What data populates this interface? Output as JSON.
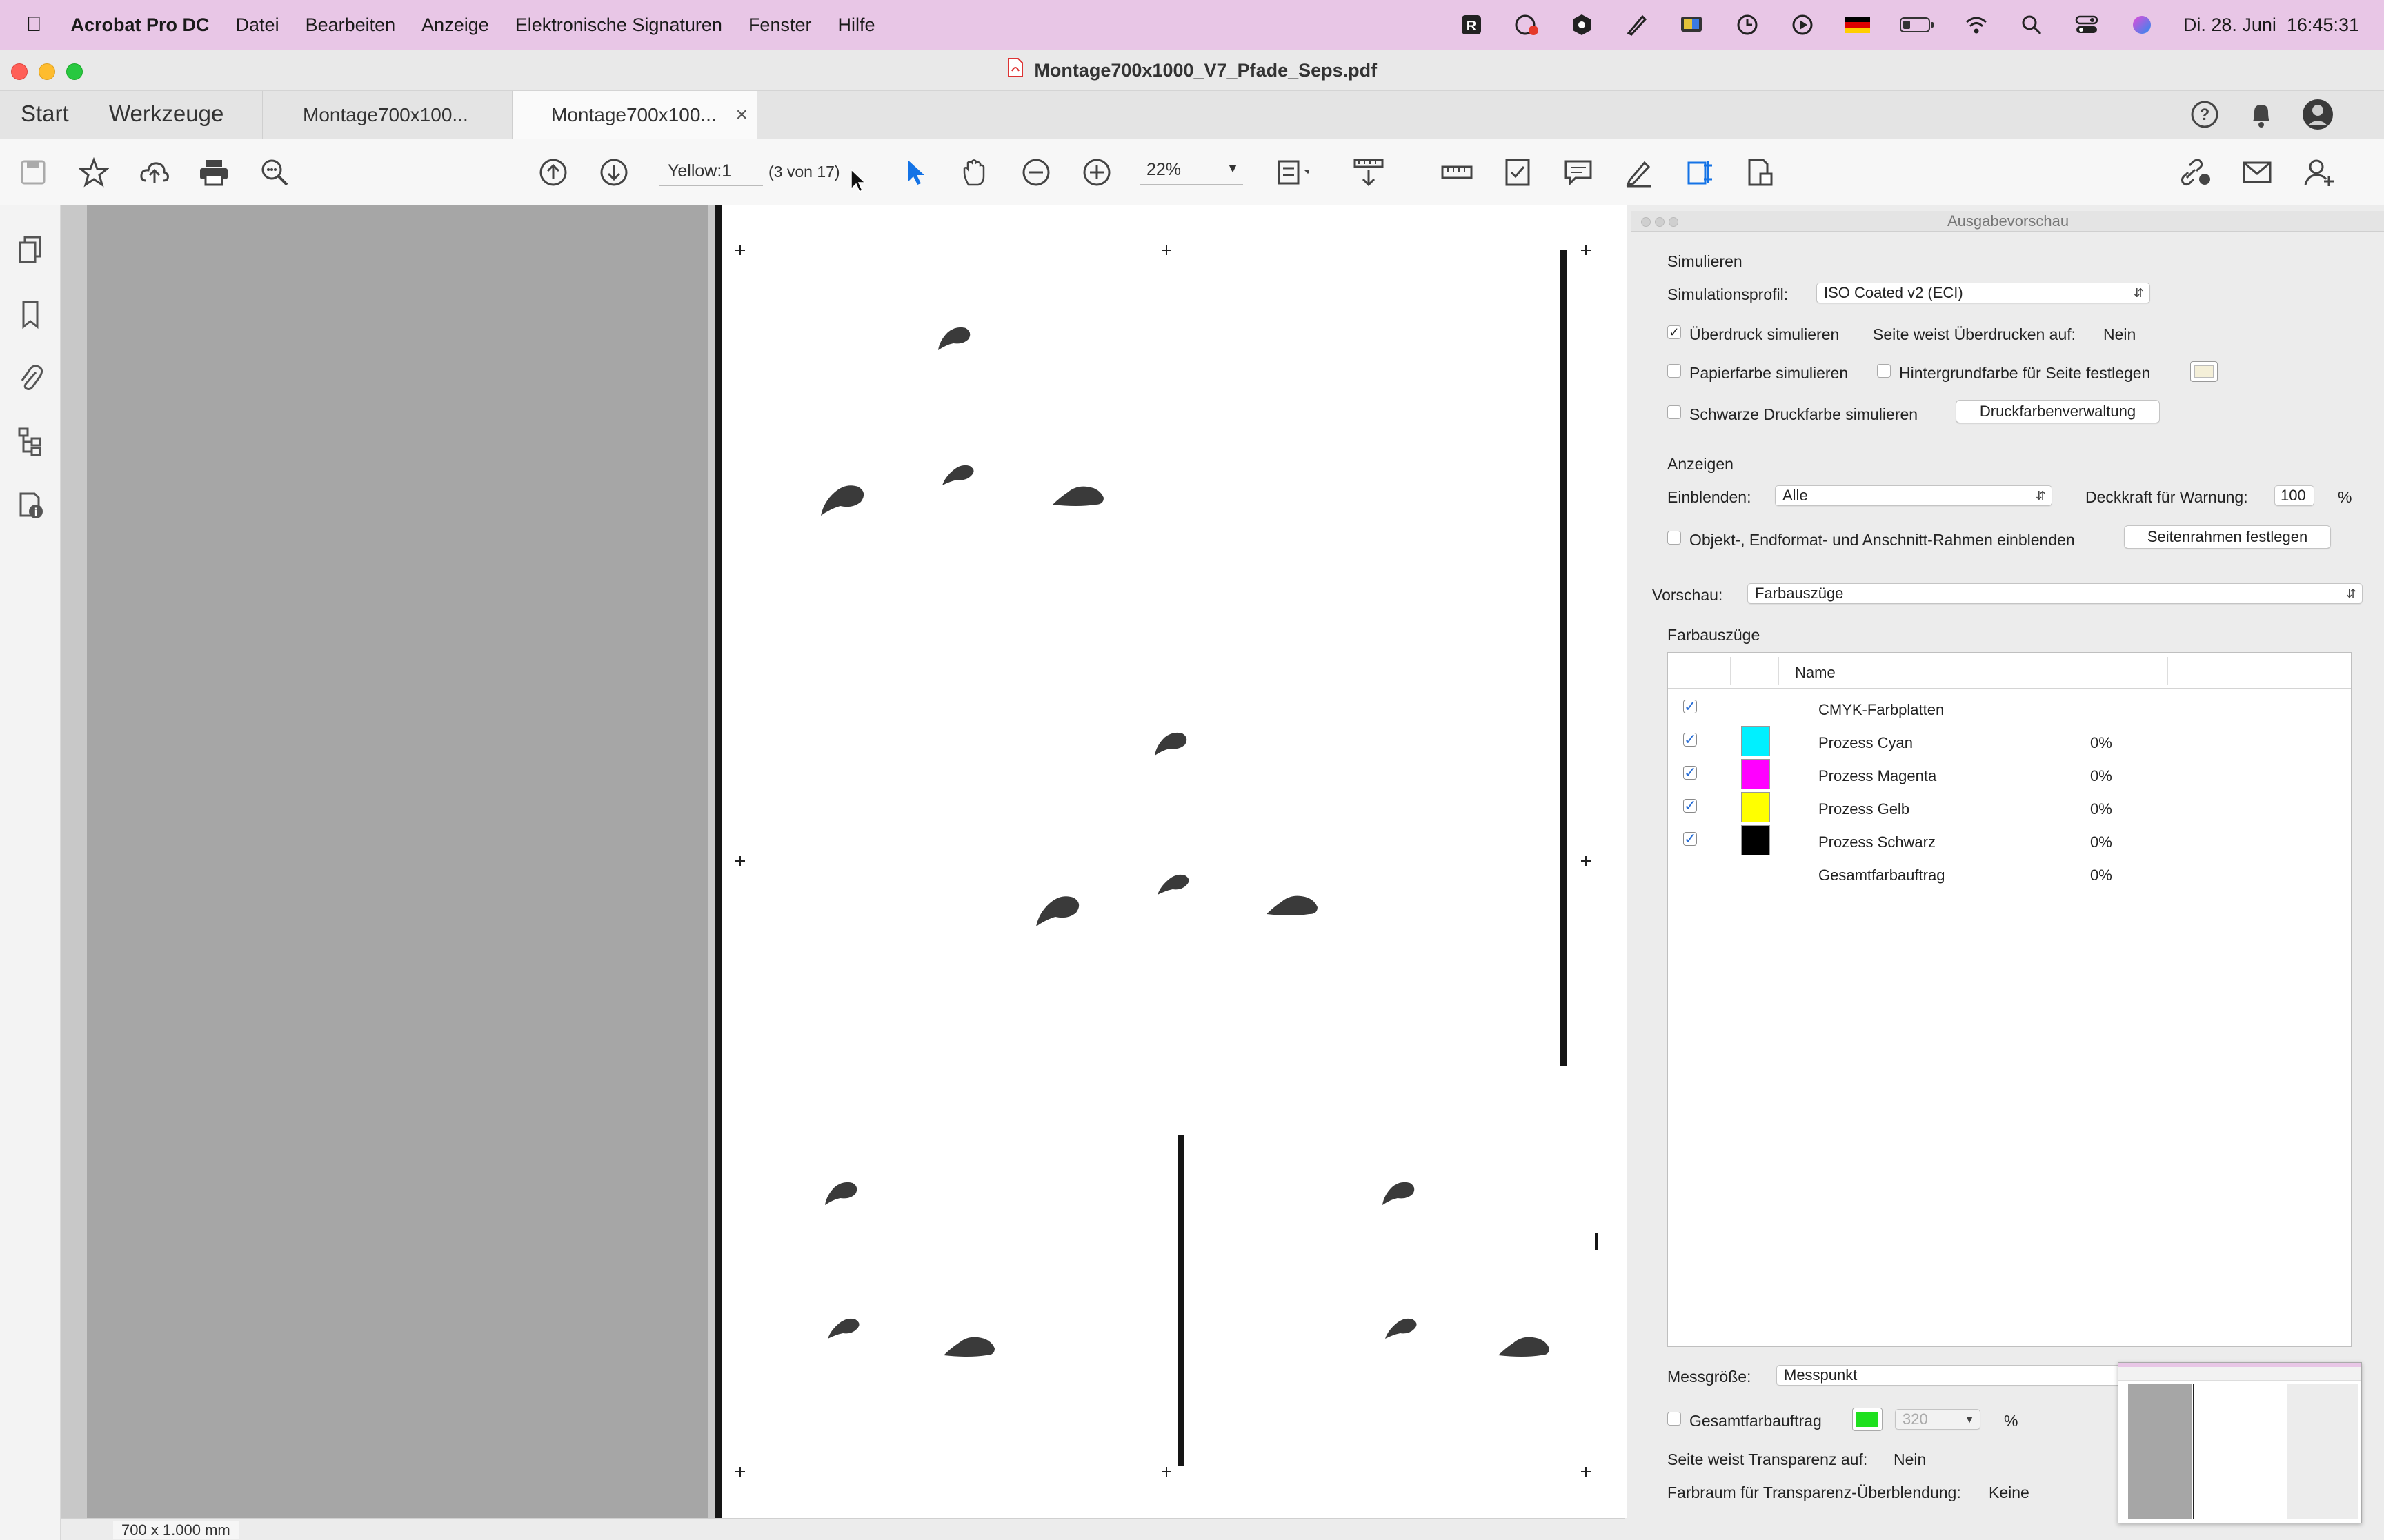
{
  "menubar": {
    "app": "Acrobat Pro DC",
    "items": [
      "Datei",
      "Bearbeiten",
      "Anzeige",
      "Elektronische Signaturen",
      "Fenster",
      "Hilfe"
    ],
    "datetime": "Di. 28. Juni  16:45:31",
    "icons": [
      "ps-icon",
      "gauge-icon",
      "hex-icon",
      "pen-icon",
      "display-icon",
      "history-icon",
      "play-icon",
      "flag-de-icon",
      "battery-icon",
      "wifi-icon",
      "search-icon",
      "control-center-icon",
      "siri-icon"
    ]
  },
  "window": {
    "title": "Montage700x1000_V7_Pfade_Seps.pdf"
  },
  "tabs": {
    "start": "Start",
    "tools": "Werkzeuge",
    "documents": [
      {
        "label": "Montage700x100..."
      },
      {
        "label": "Montage700x100..."
      }
    ],
    "close_glyph": "×"
  },
  "toolbar": {
    "page_field": "Yellow:1",
    "page_count": "(3 von 17)",
    "zoom": "22%"
  },
  "document": {
    "page_size": "700 x 1.000 mm"
  },
  "panel": {
    "title": "Ausgabevorschau",
    "simulate": {
      "heading": "Simulieren",
      "profile_label": "Simulationsprofil:",
      "profile_value": "ISO Coated v2 (ECI)",
      "overprint_label": "Überdruck simulieren",
      "overprint_checked": true,
      "page_overprint_label": "Seite weist Überdrucken auf:",
      "page_overprint_value": "Nein",
      "paper_label": "Papierfarbe simulieren",
      "background_label": "Hintergrundfarbe für Seite festlegen",
      "black_ink_label": "Schwarze Druckfarbe simulieren",
      "ink_manager_button": "Druckfarbenverwaltung"
    },
    "show": {
      "heading": "Anzeigen",
      "show_label": "Einblenden:",
      "show_value": "Alle",
      "opacity_label": "Deckkraft für Warnung:",
      "opacity_value": "100",
      "opacity_unit": "%",
      "frames_label": "Objekt-, Endformat- und Anschnitt-Rahmen einblenden",
      "frames_button": "Seitenrahmen festlegen"
    },
    "preview": {
      "label": "Vorschau:",
      "value": "Farbauszüge"
    },
    "separations": {
      "heading": "Farbauszüge",
      "column_name": "Name",
      "rows": [
        {
          "name": "CMYK-Farbplatten",
          "checked": true,
          "color": "",
          "value": ""
        },
        {
          "name": "Prozess Cyan",
          "checked": true,
          "color": "#00f0ff",
          "value": "0%"
        },
        {
          "name": "Prozess Magenta",
          "checked": true,
          "color": "#ff00ff",
          "value": "0%"
        },
        {
          "name": "Prozess Gelb",
          "checked": true,
          "color": "#ffff00",
          "value": "0%"
        },
        {
          "name": "Prozess Schwarz",
          "checked": true,
          "color": "#000000",
          "value": "0%"
        },
        {
          "name": "Gesamtfarbauftrag",
          "checked": false,
          "color": "",
          "value": "0%"
        }
      ]
    },
    "measure": {
      "label": "Messgröße:",
      "value": "Messpunkt",
      "total_label": "Gesamtfarbauftrag",
      "total_color": "#1ee01e",
      "total_value": "320",
      "total_unit": "%",
      "transparency_label": "Seite weist Transparenz auf:",
      "transparency_value": "Nein",
      "blend_label": "Farbraum für Transparenz-Überblendung:",
      "blend_value": "Keine"
    }
  }
}
